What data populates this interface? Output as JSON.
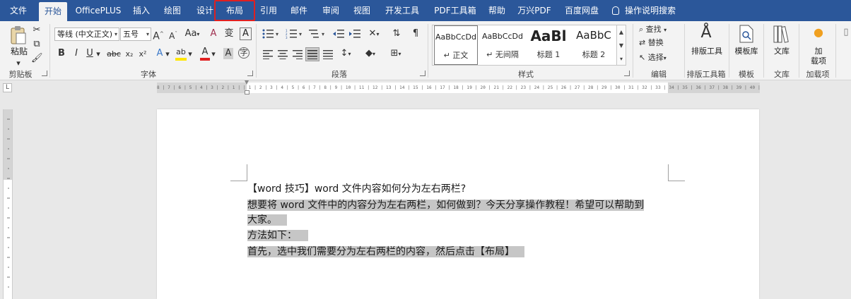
{
  "tabs": [
    {
      "label": "文件",
      "active": false
    },
    {
      "label": "开始",
      "active": true
    },
    {
      "label": "OfficePLUS",
      "active": false
    },
    {
      "label": "插入",
      "active": false
    },
    {
      "label": "绘图",
      "active": false
    },
    {
      "label": "设计",
      "active": false
    },
    {
      "label": "布局",
      "active": false,
      "highlighted": true
    },
    {
      "label": "引用",
      "active": false
    },
    {
      "label": "邮件",
      "active": false
    },
    {
      "label": "审阅",
      "active": false
    },
    {
      "label": "视图",
      "active": false
    },
    {
      "label": "开发工具",
      "active": false
    },
    {
      "label": "PDF工具箱",
      "active": false
    },
    {
      "label": "帮助",
      "active": false
    },
    {
      "label": "万兴PDF",
      "active": false
    },
    {
      "label": "百度网盘",
      "active": false
    }
  ],
  "tell_me": "操作说明搜索",
  "colors": {
    "title_bar": "#2b579a",
    "highlight_box": "#e02020",
    "selection": "#c6c6c6",
    "highlight_yellow": "#ffe600",
    "font_red": "#e02020"
  },
  "ribbon": {
    "clipboard": {
      "paste": "粘贴",
      "label": "剪贴板"
    },
    "font": {
      "name": "等线 (中文正文)",
      "size": "五号",
      "grow": "A",
      "shrink": "A",
      "case": "Aa",
      "clear": "A",
      "phonetic": "变",
      "border_char": "A",
      "bold": "B",
      "italic": "I",
      "underline": "U",
      "strike": "abc",
      "sub": "x₂",
      "sup": "x²",
      "effects": "A",
      "highlight": "ab",
      "color": "A",
      "shade": "A",
      "enclose": "字",
      "label": "字体"
    },
    "paragraph": {
      "label": "段落"
    },
    "styles": {
      "items": [
        {
          "sample": "AaBbCcDd",
          "name": "↵ 正文"
        },
        {
          "sample": "AaBbCcDd",
          "name": "↵ 无间隔"
        },
        {
          "sample": "AaBl",
          "name": "标题 1"
        },
        {
          "sample": "AaBbC",
          "name": "标题 2"
        }
      ],
      "label": "样式"
    },
    "editing": {
      "find": "查找",
      "replace": "替换",
      "select": "选择",
      "label": "编辑"
    },
    "layout_tools": {
      "button": "排版工具",
      "label": "排版工具箱"
    },
    "templates": {
      "button": "模板库",
      "label": "模板"
    },
    "library": {
      "button": "文库",
      "label": "文库"
    },
    "addins": {
      "button_line1": "加",
      "button_line2": "载项",
      "label": "加载项"
    }
  },
  "ruler": {
    "numbers": "8 | 7 | 6 | 5 | 4 | 3 | 2 | 1 |   | 1 | 2 | 3 | 4 | 5 | 6 | 7 | 8 | 9 | 10 | 11 | 12 | 13 | 14 | 15 | 16 | 17 | 18 | 19 | 20 | 21 | 22 | 23 | 24 | 25 | 26 | 27 | 28 | 29 | 30 | 31 | 32 | 33 | 34 | 35 | 36 | 37 | 38 | 39 | 40 | 41 | 42 | 43 | 44 | 45 | 46 | 47 | 48"
  },
  "document": {
    "lines": [
      {
        "text": "【word 技巧】word 文件内容如何分为左右两栏?",
        "selected": false
      },
      {
        "text": "想要将 word 文件中的内容分为左右两栏，如何做到？今天分享操作教程！希望可以帮助到",
        "selected": true
      },
      {
        "text": "大家。",
        "selected": true
      },
      {
        "text": "方法如下：",
        "selected": true
      },
      {
        "text": "首先，选中我们需要分为左右两栏的内容，然后点击【布局】",
        "selected": true
      }
    ]
  }
}
